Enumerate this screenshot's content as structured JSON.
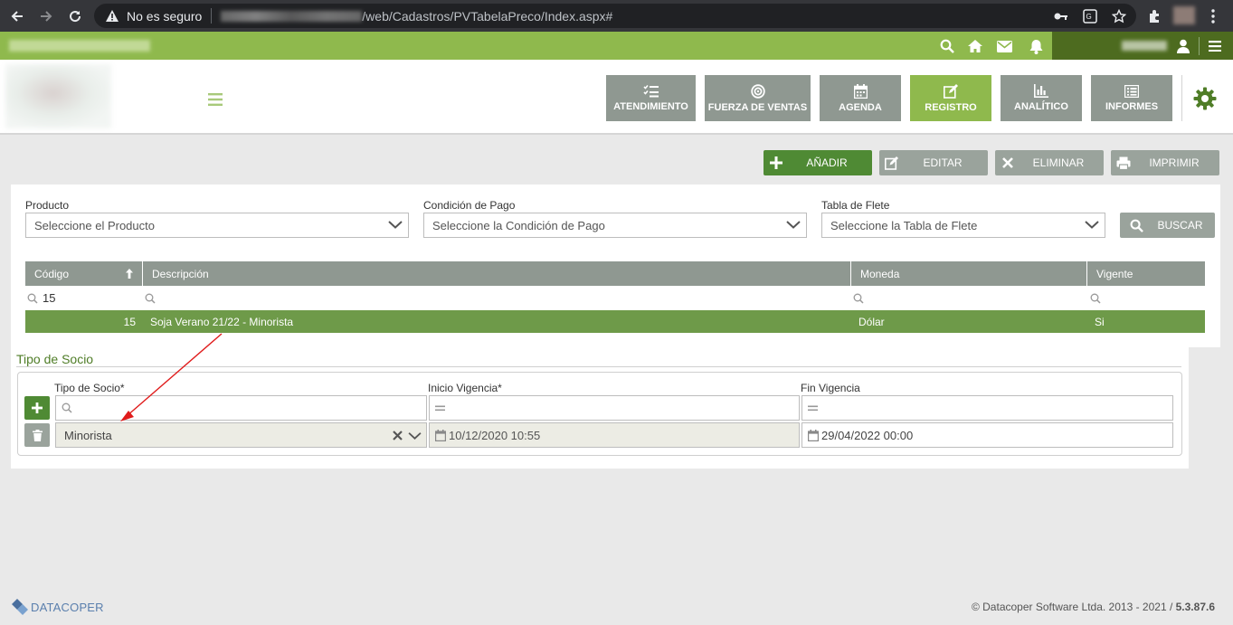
{
  "browser": {
    "security_label": "No es seguro",
    "url_path": "/web/Cadastros/PVTabelaPreco/Index.aspx#"
  },
  "header": {
    "nav": [
      {
        "label": "ATENDIMIENTO",
        "icon": "checklist-icon"
      },
      {
        "label": "FUERZA DE VENTAS",
        "icon": "target-icon"
      },
      {
        "label": "AGENDA",
        "icon": "calendar-icon"
      },
      {
        "label": "REGISTRO",
        "icon": "edit-icon"
      },
      {
        "label": "ANALÍTICO",
        "icon": "bar-chart-icon"
      },
      {
        "label": "INFORMES",
        "icon": "list-icon"
      }
    ],
    "active_nav": "REGISTRO"
  },
  "actions": {
    "add": "AÑADIR",
    "edit": "EDITAR",
    "delete": "ELIMINAR",
    "print": "IMPRIMIR"
  },
  "filters": {
    "producto_label": "Producto",
    "producto_value": "Seleccione el Producto",
    "condicion_label": "Condición de Pago",
    "condicion_value": "Seleccione la Condición de Pago",
    "flete_label": "Tabla de Flete",
    "flete_value": "Seleccione la Tabla de Flete",
    "search_button": "BUSCAR"
  },
  "grid": {
    "columns": [
      "Código",
      "Descripción",
      "Moneda",
      "Vigente"
    ],
    "filter_codigo": "15",
    "rows": [
      {
        "codigo": "15",
        "descripcion": "Soja Verano 21/22 - Minorista",
        "moneda": "Dólar",
        "vigente": "Si"
      }
    ]
  },
  "tipo_socio": {
    "section_title": "Tipo de Socio",
    "col_tipo": "Tipo de Socio*",
    "col_inicio": "Inicio Vigencia*",
    "col_fin": "Fin Vigencia",
    "row": {
      "tipo": "Minorista",
      "inicio": "10/12/2020 10:55",
      "fin": "29/04/2022 00:00"
    }
  },
  "footer": {
    "brand": "DATACOPER",
    "copyright": "© Datacoper Software Ltda. 2013 - 2021 / ",
    "version": "5.3.87.6"
  },
  "colors": {
    "green_bar": "#8fb94d",
    "dark_green": "#4d6b1f",
    "active_row": "#6e9a49",
    "gray_button": "#9aa39c",
    "add_button": "#4f8a34"
  }
}
